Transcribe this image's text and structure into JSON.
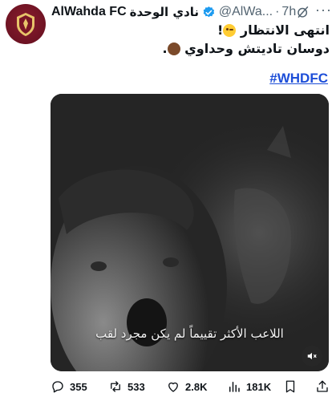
{
  "post": {
    "author_name_en": "AlWahda FC",
    "author_name_ar": "نادي الوحدة",
    "handle": "@AlWa...",
    "separator": "·",
    "time": "7h",
    "text_line1": "انتهى الانتظار",
    "text_line1_end": "!",
    "text_line2": "دوسان تاديتش وحداوي",
    "text_line2_end": ".",
    "hashtag": "#WHDFC"
  },
  "video": {
    "caption": "اللاعب الأكثر تقييماً لم يكن مجرد لقب"
  },
  "actions": {
    "replies": "355",
    "reposts": "533",
    "likes": "2.8K",
    "views": "181K"
  },
  "colors": {
    "accent": "#1d4ed8",
    "verified": "#1d9bf0",
    "avatar": "#6e1323",
    "muted": "#536471"
  },
  "icons": [
    "club-crest-icon",
    "verified-icon",
    "grok-icon",
    "more-icon",
    "mute-icon",
    "reply-icon",
    "repost-icon",
    "like-icon",
    "views-icon",
    "bookmark-icon",
    "share-icon"
  ]
}
